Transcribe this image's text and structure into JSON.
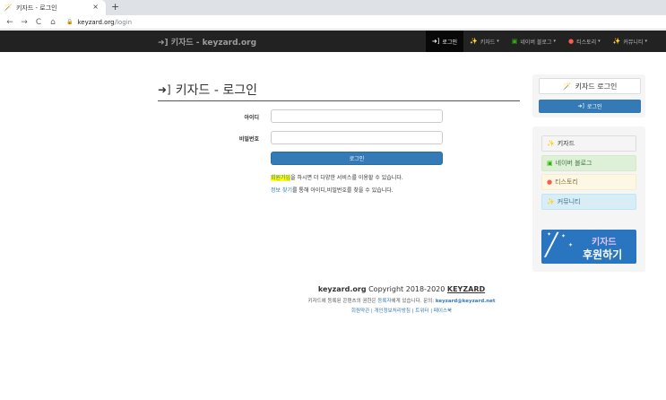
{
  "browser": {
    "tab_title": "키자드 - 로그인",
    "tab_close": "×",
    "new_tab": "+",
    "url_host": "keyzard.org",
    "url_path": "/login"
  },
  "navbar": {
    "brand": "키자드 - keyzard.org",
    "items": [
      {
        "label": "로그인",
        "icon": "sign-in-icon",
        "active": true
      },
      {
        "label": "키자드",
        "icon": "magic-wand-icon",
        "dropdown": true
      },
      {
        "label": "네이버 블로그",
        "icon": "naver-icon",
        "dropdown": true
      },
      {
        "label": "티스토리",
        "icon": "tistory-icon",
        "dropdown": true
      },
      {
        "label": "커뮤니티",
        "icon": "sparkle-icon",
        "dropdown": true
      }
    ]
  },
  "login": {
    "title": "키자드 - 로그인",
    "id_label": "아이디",
    "id_value": "",
    "password_label": "비밀번호",
    "password_value": "",
    "submit_label": "로그인",
    "signup_link": "회원가입",
    "signup_text": "을 하시면 더 다양한 서비스를 이용할 수 있습니다.",
    "find_link": "정보 찾기",
    "find_text": "를 통해 아이디,비밀번호를 찾을 수 있습니다."
  },
  "sidebar": {
    "login_heading": "키자드 로그인",
    "login_button": "로그인",
    "links": [
      {
        "label": "키자드",
        "icon": "magic-wand-icon"
      },
      {
        "label": "네이버 블로그",
        "icon": "naver-icon"
      },
      {
        "label": "티스토리",
        "icon": "tistory-icon"
      },
      {
        "label": "커뮤니티",
        "icon": "sparkle-icon"
      }
    ],
    "donate_line1": "키자드",
    "donate_line2": "후원하기"
  },
  "footer": {
    "site": "keyzard.org",
    "copyright": "Copyright 2018-2020",
    "brand": "KEYZARD",
    "rights_pre": "키자드에 등록된 콘텐츠의 권한은",
    "rights_link": "등록자",
    "rights_post": "에게 있습니다. 문의:",
    "email": "keyzard@keyzard.net",
    "links": "회원약관 | 개인정보처리방침 | 트위터 | 페이스북"
  },
  "colors": {
    "navbar_bg": "#222222",
    "primary": "#337ab7",
    "highlight": "#ffff00"
  }
}
